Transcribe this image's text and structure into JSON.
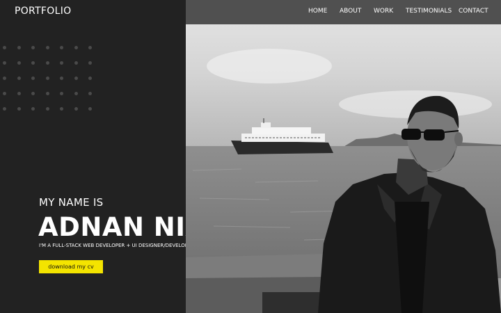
{
  "brand": {
    "logo": "PORTFOLIO"
  },
  "nav": {
    "items": [
      {
        "label": "HOME"
      },
      {
        "label": "ABOUT"
      },
      {
        "label": "WORK"
      },
      {
        "label": "TESTIMONIALS"
      },
      {
        "label": "CONTACT"
      }
    ]
  },
  "hero": {
    "eyebrow": "MY NAME IS",
    "name": "ADNAN NIAZI",
    "tagline": "I'M A FULL-STACK WEB DEVELOPER + UI DESIGNER/DEVELOPER",
    "cv_button": "download my cv"
  },
  "colors": {
    "panel": "#222222",
    "navbar": "#505050",
    "accent": "#f4e400"
  },
  "photo": {
    "subject": "black-and-white portrait of a man in a leather jacket and sunglasses by the sea with a ferry in the background"
  }
}
